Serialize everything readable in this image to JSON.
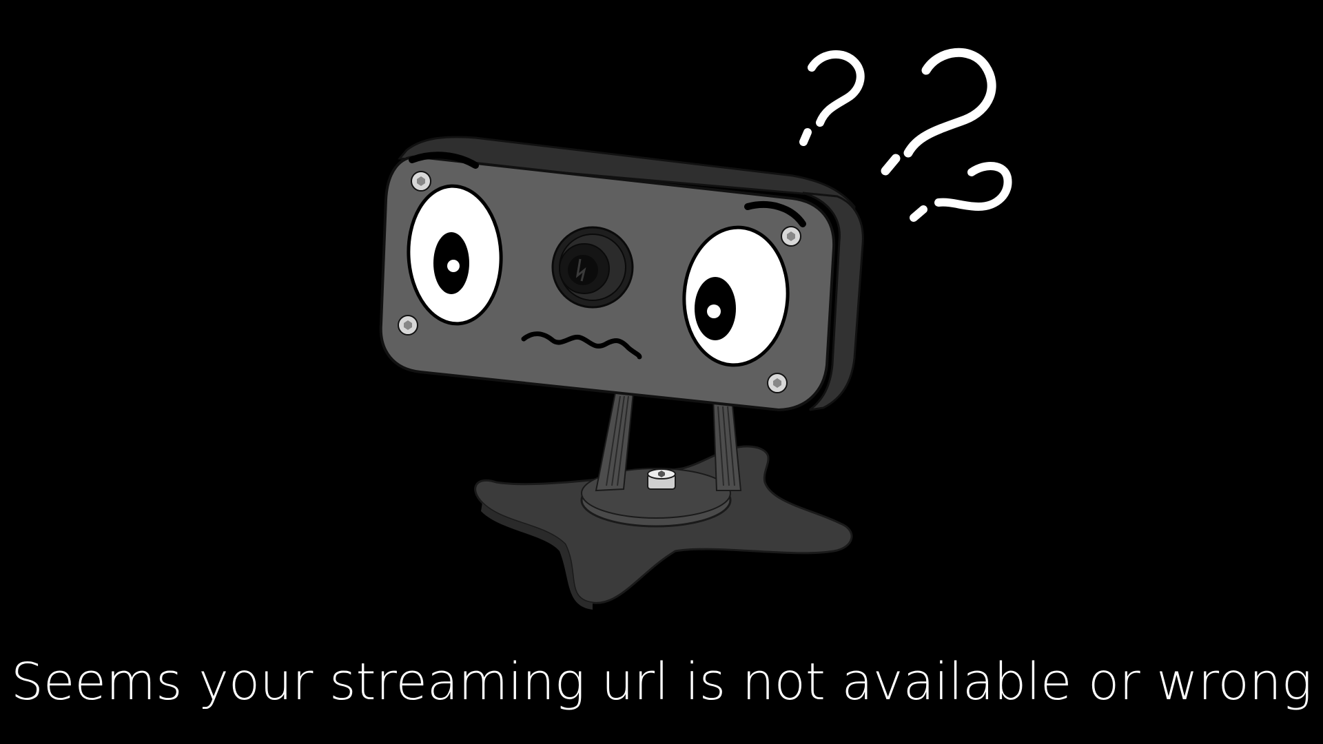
{
  "message": {
    "text": "Seems your streaming url is not available or wrong"
  },
  "illustration": {
    "subject": "confused-webcam-mascot",
    "question_mark_count": 3
  },
  "colors": {
    "background": "#000000",
    "text": "#ffffff",
    "camera_body": "#5f5f5f",
    "camera_dark": "#2f2f2f",
    "question_marks": "#ffffff"
  }
}
